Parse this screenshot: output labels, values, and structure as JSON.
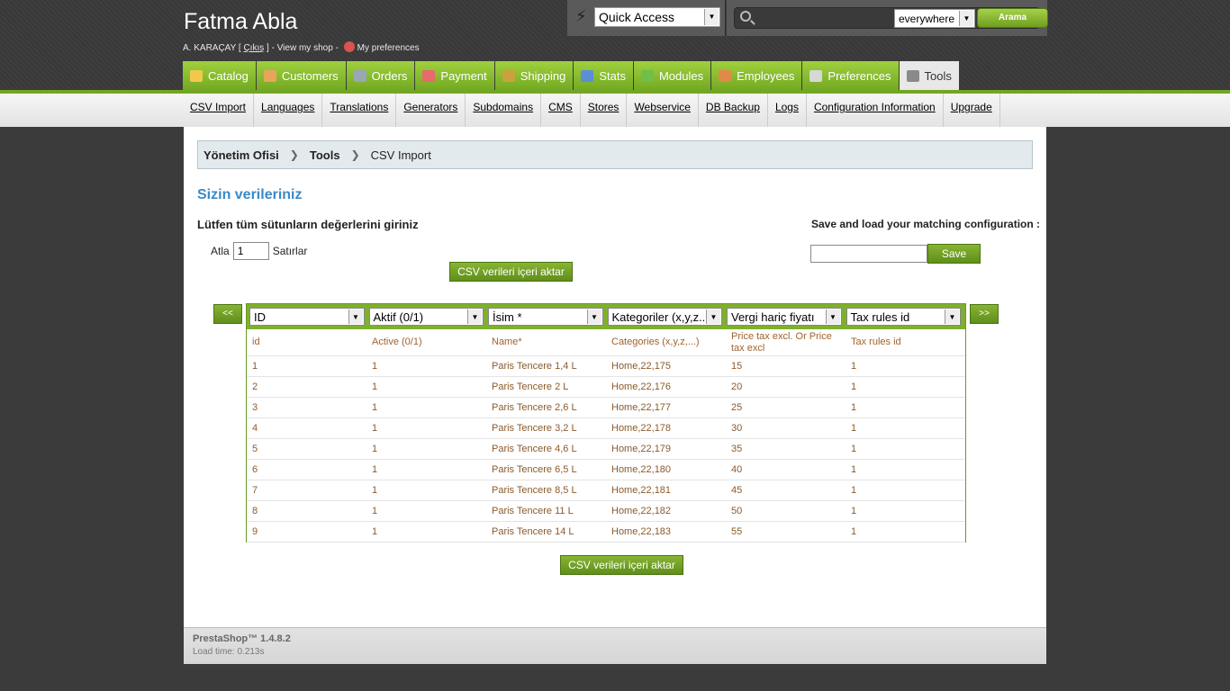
{
  "header": {
    "shop_name": "Fatma Abla",
    "user_name": "A. KARAÇAY",
    "logout_label": "Çıkış",
    "view_shop_label": "View my shop",
    "preferences_label": "My preferences",
    "quick_access": "Quick Access",
    "search_scope": "everywhere",
    "search_button": "Arama",
    "search_value": ""
  },
  "main_tabs": [
    {
      "label": "Catalog",
      "icon": "catalog-icon",
      "color": "#f2c84b"
    },
    {
      "label": "Customers",
      "icon": "customers-icon",
      "color": "#e8a55a"
    },
    {
      "label": "Orders",
      "icon": "orders-icon",
      "color": "#9aa7b5"
    },
    {
      "label": "Payment",
      "icon": "payment-icon",
      "color": "#e86a6a"
    },
    {
      "label": "Shipping",
      "icon": "shipping-icon",
      "color": "#c9a23e"
    },
    {
      "label": "Stats",
      "icon": "stats-icon",
      "color": "#5a8fd6"
    },
    {
      "label": "Modules",
      "icon": "modules-icon",
      "color": "#6fbf4a"
    },
    {
      "label": "Employees",
      "icon": "employees-icon",
      "color": "#e08a4a"
    },
    {
      "label": "Preferences",
      "icon": "preferences-icon",
      "color": "#d7d7d7"
    },
    {
      "label": "Tools",
      "icon": "tools-icon",
      "color": "#8a8a8a"
    }
  ],
  "sub_menu": [
    "CSV Import",
    "Languages",
    "Translations",
    "Generators",
    "Subdomains",
    "CMS",
    "Stores",
    "Webservice",
    "DB Backup",
    "Logs",
    "Configuration Information",
    "Upgrade"
  ],
  "breadcrumb": {
    "root": "Yönetim Ofisi",
    "section": "Tools",
    "page": "CSV Import"
  },
  "page": {
    "title": "Sizin verileriniz",
    "instruction": "Lütfen tüm sütunların değerlerini giriniz",
    "skip_label": "Atla",
    "skip_value": "1",
    "rows_label": "Satırlar",
    "import_button": "CSV verileri içeri aktar",
    "save_config_label": "Save and load your matching configuration :",
    "save_button": "Save",
    "prev_button": "<<",
    "next_button": ">>"
  },
  "table": {
    "selects": [
      "ID",
      "Aktif (0/1)",
      "İsim *",
      "Kategoriler (x,y,z...)",
      "Vergi hariç fiyatı",
      "Tax rules id"
    ],
    "headers": [
      "id",
      "Active (0/1)",
      "Name*",
      "Categories (x,y,z,...)",
      "Price tax excl. Or Price tax excl",
      "Tax rules id"
    ],
    "rows": [
      [
        "1",
        "1",
        "Paris Tencere 1,4 L",
        "Home,22,175",
        "15",
        "1"
      ],
      [
        "2",
        "1",
        "Paris Tencere 2 L",
        "Home,22,176",
        "20",
        "1"
      ],
      [
        "3",
        "1",
        "Paris Tencere 2,6 L",
        "Home,22,177",
        "25",
        "1"
      ],
      [
        "4",
        "1",
        "Paris Tencere 3,2 L",
        "Home,22,178",
        "30",
        "1"
      ],
      [
        "5",
        "1",
        "Paris Tencere 4,6 L",
        "Home,22,179",
        "35",
        "1"
      ],
      [
        "6",
        "1",
        "Paris Tencere 6,5 L",
        "Home,22,180",
        "40",
        "1"
      ],
      [
        "7",
        "1",
        "Paris Tencere 8,5 L",
        "Home,22,181",
        "45",
        "1"
      ],
      [
        "8",
        "1",
        "Paris Tencere 11 L",
        "Home,22,182",
        "50",
        "1"
      ],
      [
        "9",
        "1",
        "Paris Tencere 14 L",
        "Home,22,183",
        "55",
        "1"
      ]
    ]
  },
  "footer": {
    "brand": "PrestaShop™ 1.4.8.2",
    "load_time": "Load time: 0.213s"
  }
}
